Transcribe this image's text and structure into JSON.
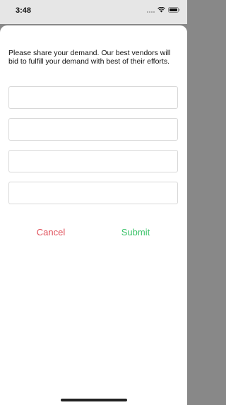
{
  "status_bar": {
    "time": "3:48",
    "icons": [
      "signal-icon",
      "wifi-icon",
      "battery-icon"
    ]
  },
  "form": {
    "prompt": "Please share your demand. Our best vendors will bid to fulfill your demand with best of their efforts.",
    "fields": [
      {
        "value": "",
        "placeholder": ""
      },
      {
        "value": "",
        "placeholder": ""
      },
      {
        "value": "",
        "placeholder": ""
      },
      {
        "value": "",
        "placeholder": ""
      }
    ],
    "cancel_label": "Cancel",
    "submit_label": "Submit"
  },
  "colors": {
    "cancel": "#e0505a",
    "submit": "#3cc36a",
    "backdrop": "#888888",
    "sheet": "#ffffff"
  }
}
